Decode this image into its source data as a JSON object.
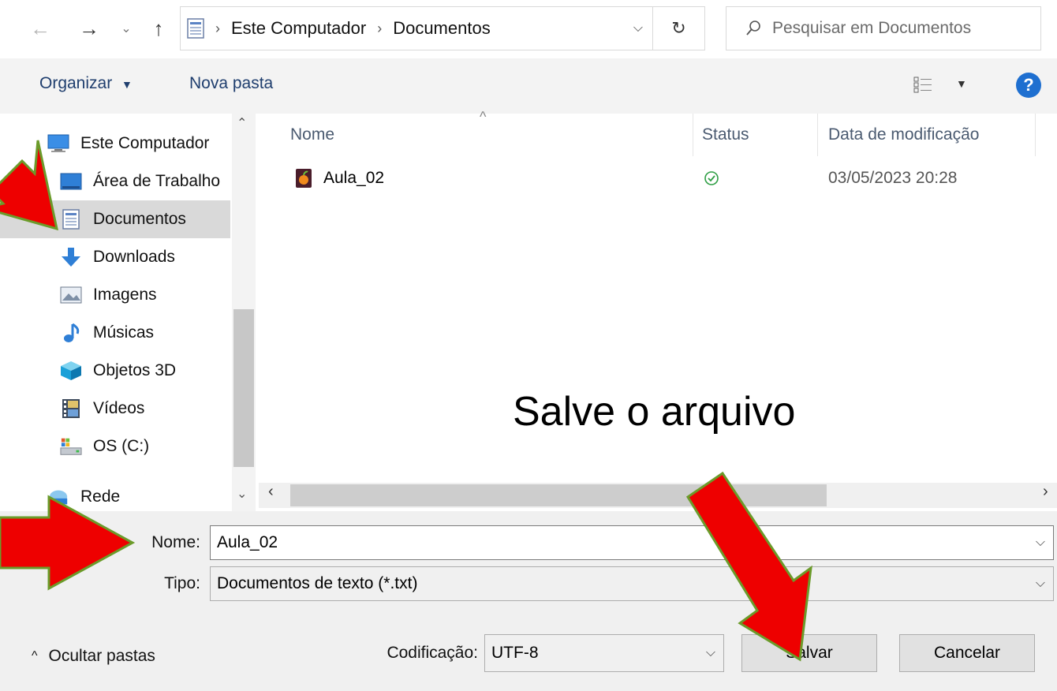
{
  "address": {
    "crumbs": [
      "Este Computador",
      "Documentos"
    ],
    "search_placeholder": "Pesquisar em Documentos"
  },
  "toolbar": {
    "organize_label": "Organizar",
    "new_folder_label": "Nova pasta"
  },
  "sidebar": {
    "items": [
      {
        "label": "Este Computador",
        "icon": "computer-icon"
      },
      {
        "label": "Área de Trabalho",
        "icon": "desktop-icon"
      },
      {
        "label": "Documentos",
        "icon": "documents-icon",
        "selected": true
      },
      {
        "label": "Downloads",
        "icon": "download-arrow-icon"
      },
      {
        "label": "Imagens",
        "icon": "pictures-icon"
      },
      {
        "label": "Músicas",
        "icon": "music-note-icon"
      },
      {
        "label": "Objetos 3D",
        "icon": "3d-cube-icon"
      },
      {
        "label": "Vídeos",
        "icon": "film-icon"
      },
      {
        "label": "OS (C:)",
        "icon": "drive-icon"
      },
      {
        "label": "Rede",
        "icon": "network-icon"
      }
    ]
  },
  "file_list": {
    "columns": [
      "Nome",
      "Status",
      "Data de modificação"
    ],
    "rows": [
      {
        "name": "Aula_02",
        "status_icon": "synced-check-icon",
        "modified": "03/05/2023 20:28"
      }
    ]
  },
  "form": {
    "name_label": "Nome:",
    "name_value": "Aula_02",
    "type_label": "Tipo:",
    "type_value": "Documentos de texto (*.txt)",
    "encoding_label": "Codificação:",
    "encoding_value": "UTF-8",
    "hide_folders_label": "Ocultar pastas",
    "save_label": "Salvar",
    "cancel_label": "Cancelar"
  },
  "annotation": {
    "caption": "Salve o arquivo",
    "arrow_color": "#ee0000",
    "arrow_border": "#6b9b2a"
  },
  "colors": {
    "selected_row": "#d9d9d9",
    "link_blue": "#1f3e6e",
    "help_blue": "#1e6fd0",
    "status_green": "#2e9e44"
  }
}
